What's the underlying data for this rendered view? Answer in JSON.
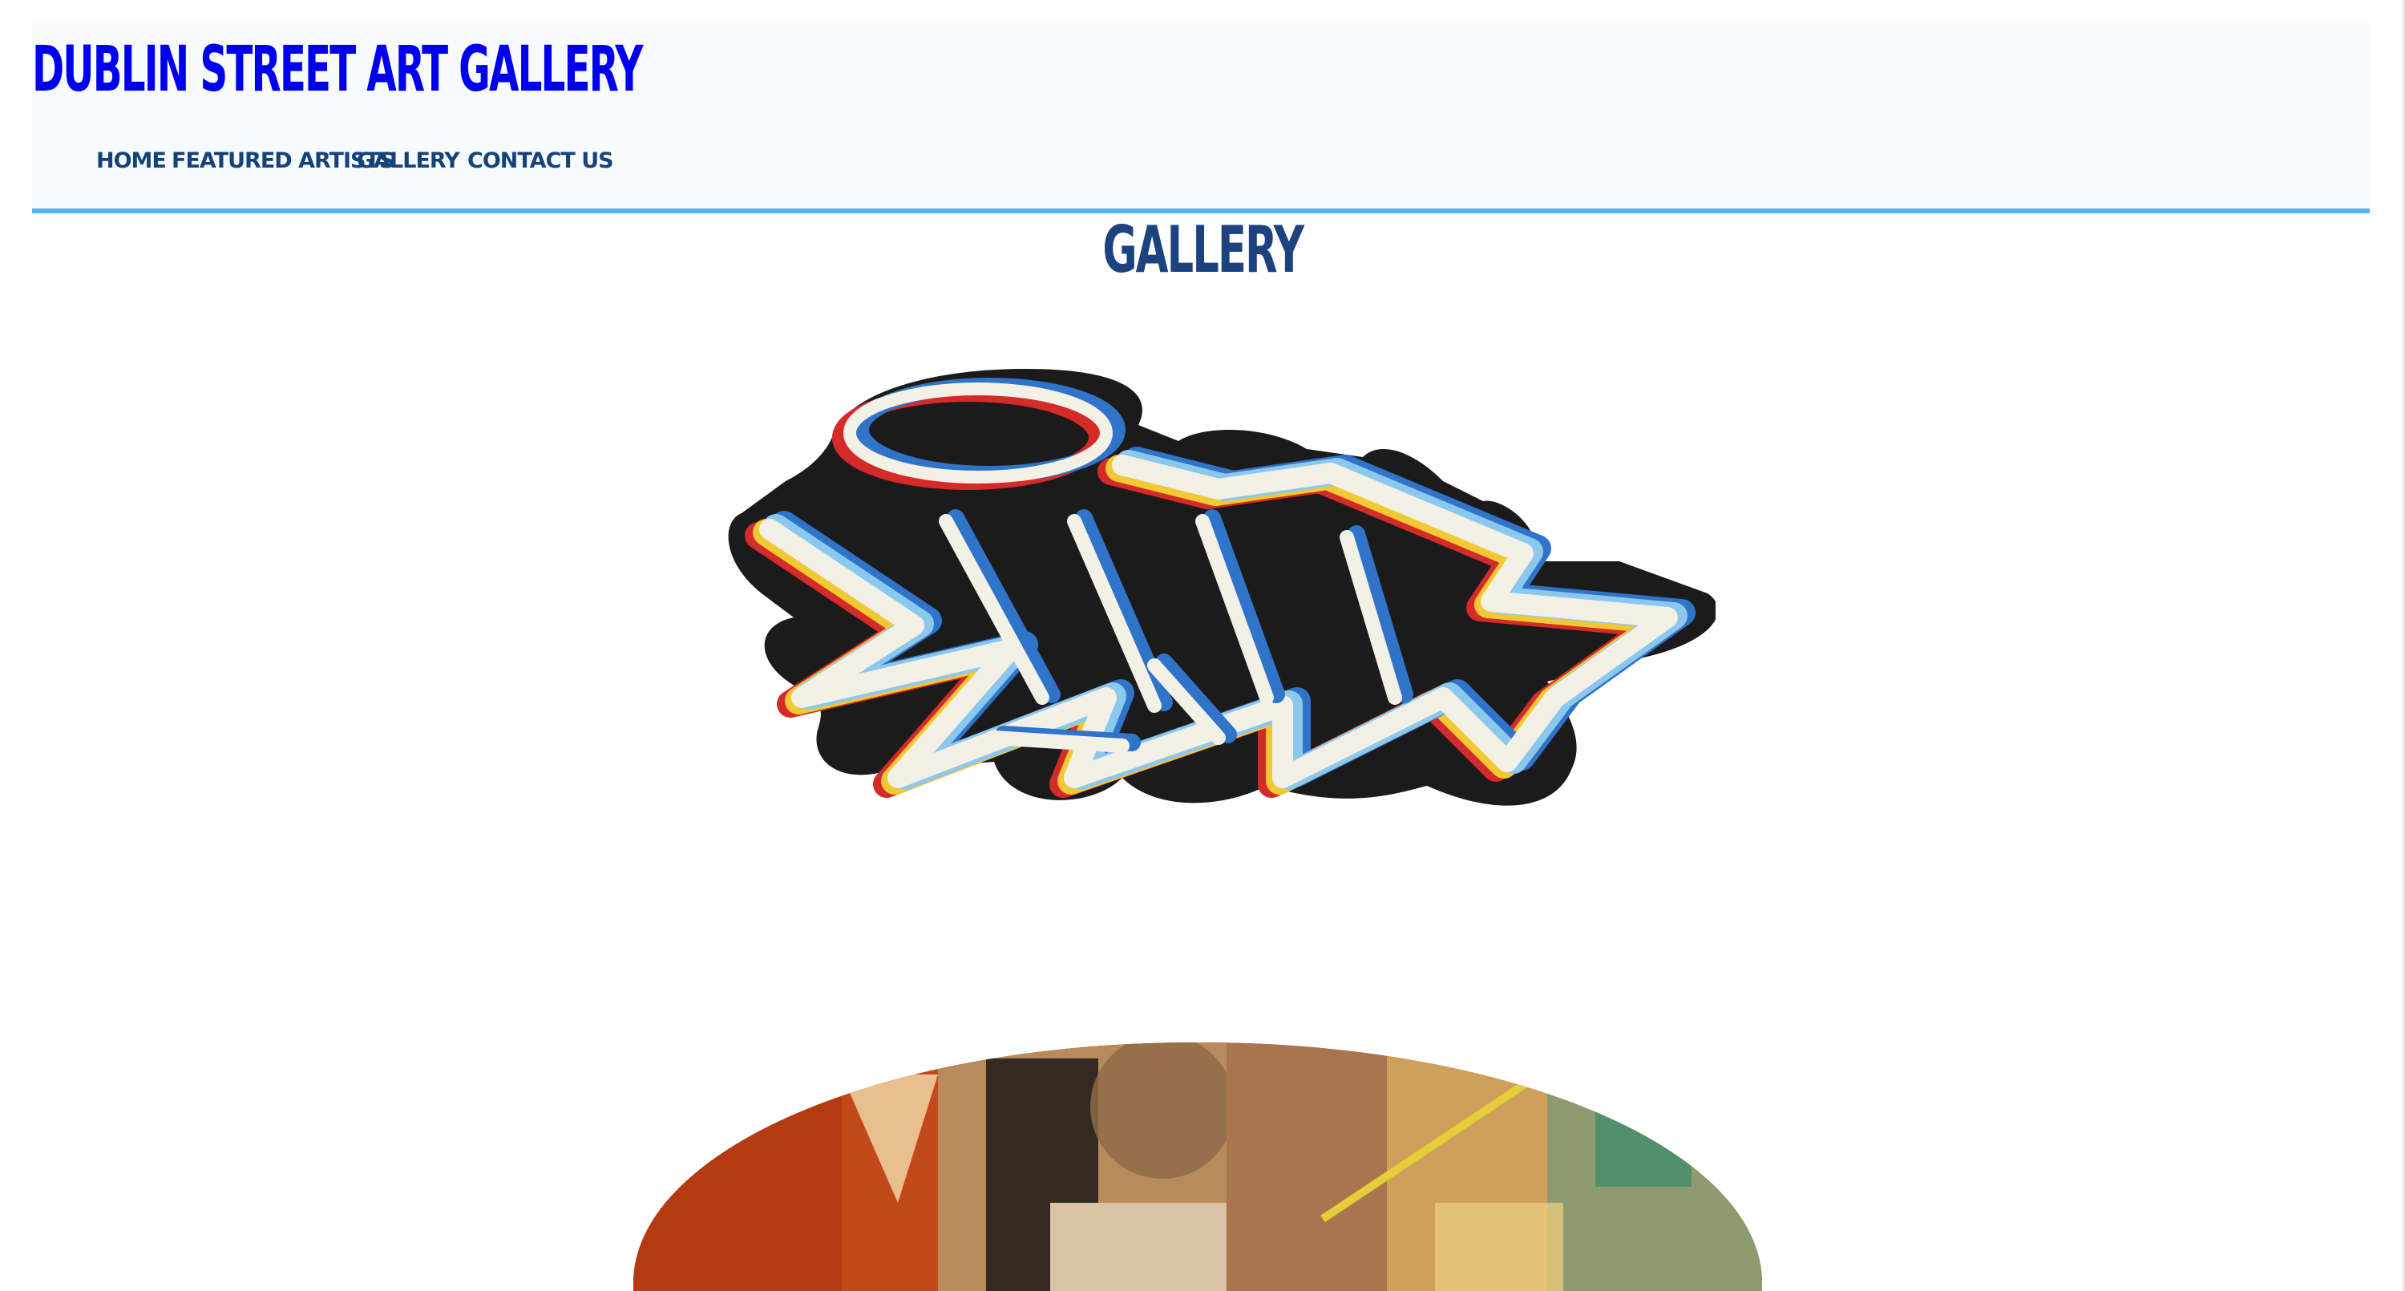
{
  "site": {
    "title": "Dublin Street Art Gallery"
  },
  "nav": {
    "items": [
      {
        "label": "Home"
      },
      {
        "label": "Featured Artists"
      },
      {
        "label": "Gallery"
      },
      {
        "label": "Contact Us"
      }
    ]
  },
  "page": {
    "heading": "Gallery"
  },
  "gallery": {
    "artworks": [
      {
        "icon": "graffiti-tag-artwork"
      },
      {
        "icon": "abstract-portrait-painting"
      }
    ]
  },
  "colors": {
    "title": "#0000ee",
    "nav_text": "#16427a",
    "heading": "#1c4380",
    "header_border": "#53b5ee",
    "header_bg": "#f7fbfd"
  }
}
